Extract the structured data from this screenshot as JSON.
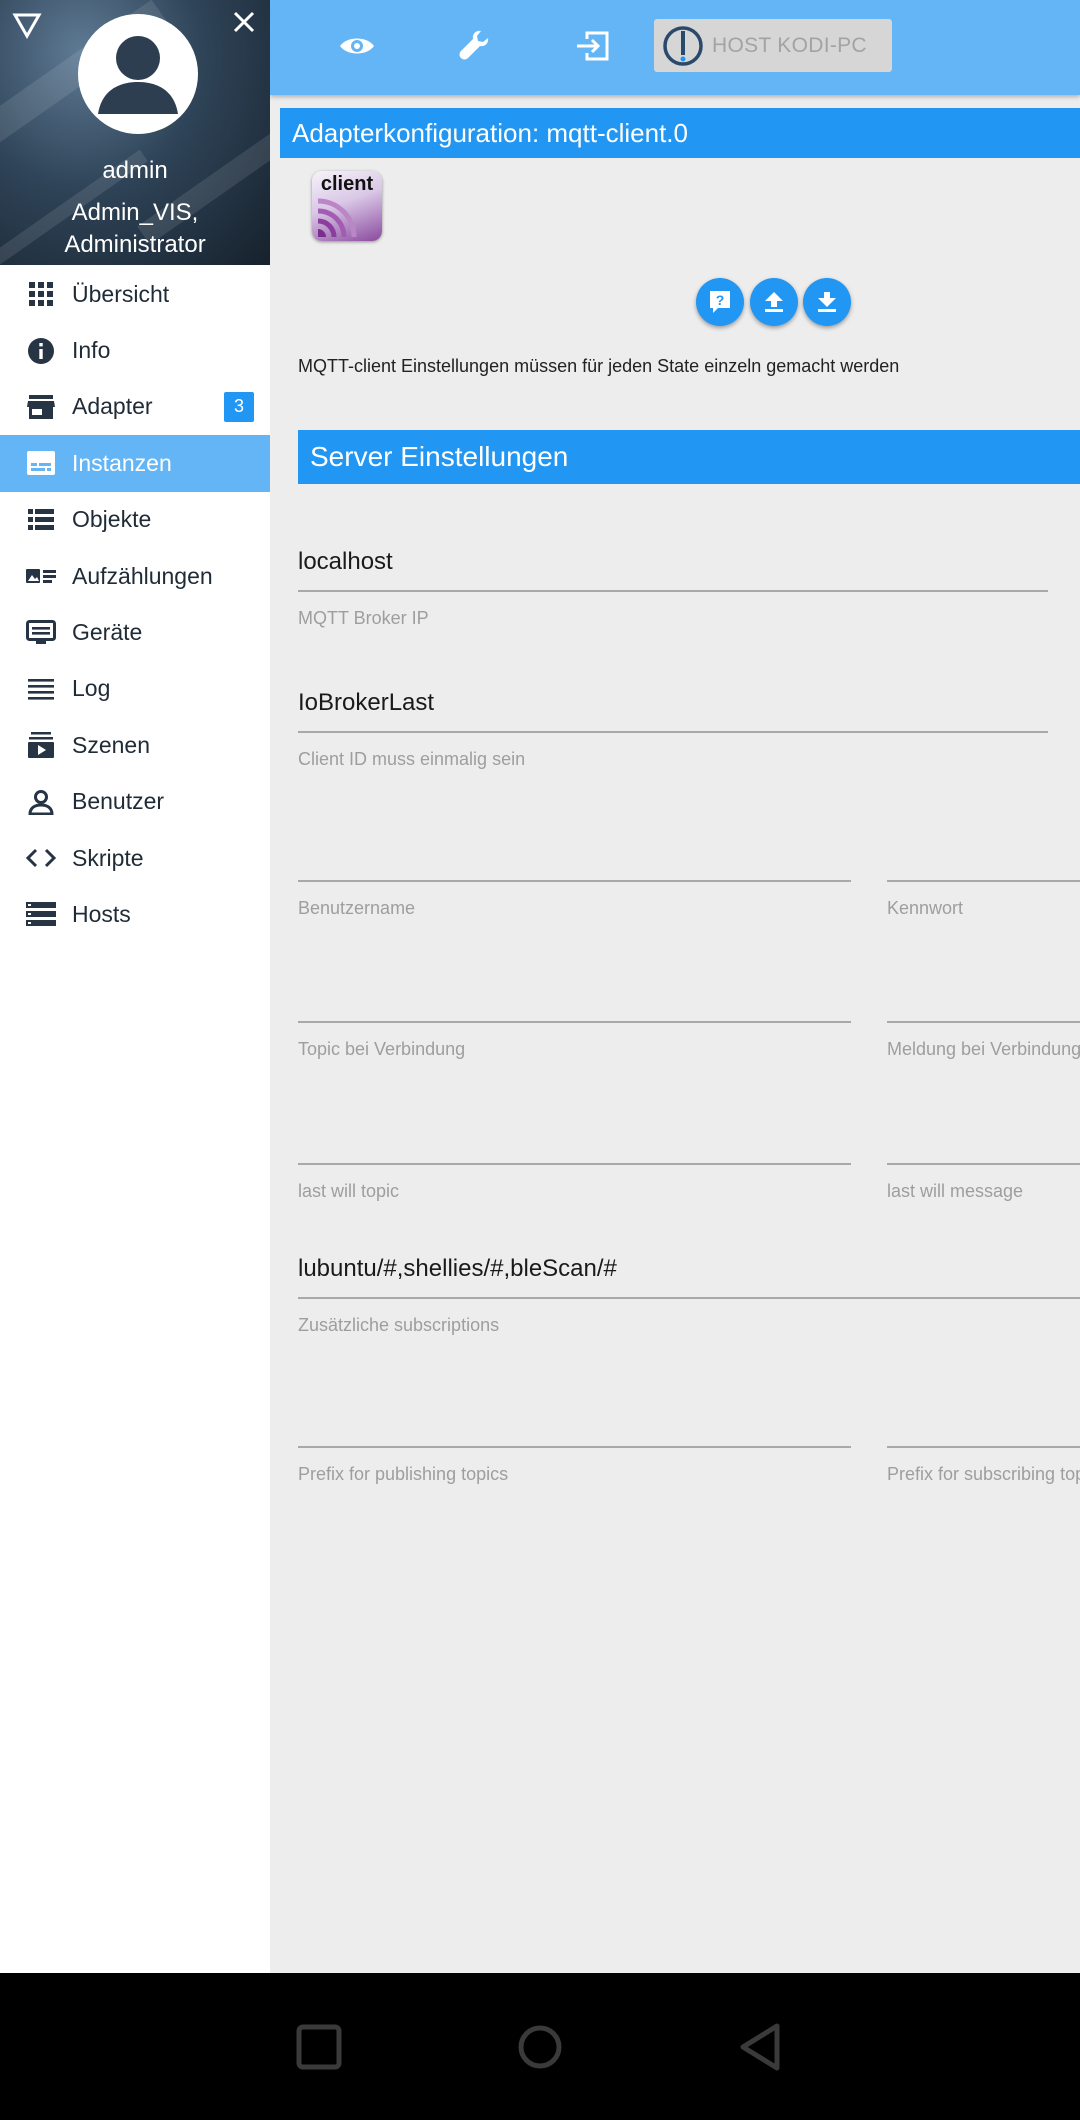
{
  "sidebar": {
    "user": {
      "name": "admin",
      "groups_line1": "Admin_VIS,",
      "groups_line2": "Administrator"
    },
    "items": [
      {
        "label": "Übersicht",
        "icon": "apps-grid-icon"
      },
      {
        "label": "Info",
        "icon": "info-icon"
      },
      {
        "label": "Adapter",
        "icon": "store-icon",
        "badge": "3"
      },
      {
        "label": "Instanzen",
        "icon": "subtitles-icon",
        "active": true
      },
      {
        "label": "Objekte",
        "icon": "list-icon"
      },
      {
        "label": "Aufzählungen",
        "icon": "enum-card-icon"
      },
      {
        "label": "Geräte",
        "icon": "devices-icon"
      },
      {
        "label": "Log",
        "icon": "lines-icon"
      },
      {
        "label": "Szenen",
        "icon": "scenes-icon"
      },
      {
        "label": "Benutzer",
        "icon": "person-icon"
      },
      {
        "label": "Skripte",
        "icon": "code-icon"
      },
      {
        "label": "Hosts",
        "icon": "storage-icon"
      }
    ]
  },
  "topbar": {
    "icons": [
      "eye-icon",
      "wrench-icon",
      "logout-icon"
    ],
    "host_label": "HOST KODI-PC"
  },
  "config": {
    "title": "Adapterkonfiguration: mqtt-client.0",
    "logo_text": "client",
    "action_icons": [
      "help-icon",
      "upload-icon",
      "download-icon"
    ],
    "description": "MQTT-client Einstellungen müssen für jeden State einzeln gemacht werden",
    "section_title": "Server Einstellungen",
    "fields": {
      "broker_ip": {
        "value": "localhost",
        "hint": "MQTT Broker IP"
      },
      "client_id": {
        "value": "IoBrokerLast",
        "hint": "Client ID muss einmalig sein"
      },
      "username": {
        "value": "",
        "hint": "Benutzername"
      },
      "password": {
        "value": "",
        "hint": "Kennwort"
      },
      "connect_topic": {
        "value": "",
        "hint": "Topic bei Verbindung"
      },
      "connect_message": {
        "value": "",
        "hint": "Meldung bei Verbindung"
      },
      "lastwill_topic": {
        "value": "",
        "hint": "last will topic"
      },
      "lastwill_message": {
        "value": "",
        "hint": "last will message"
      },
      "subscriptions": {
        "value": "lubuntu/#,shellies/#,bleScan/#",
        "hint": "Zusätzliche subscriptions"
      },
      "publish_prefix": {
        "value": "",
        "hint": "Prefix for publishing topics"
      },
      "subscribe_prefix": {
        "value": "",
        "hint": "Prefix for subscribing topics"
      }
    }
  },
  "system_nav": {
    "icons": [
      "recents-square-icon",
      "home-circle-icon",
      "back-triangle-icon"
    ]
  },
  "colors": {
    "accent": "#2196f3",
    "active_item": "#64b5f6",
    "sidebar_text": "#1f2b36",
    "content_bg": "#ededed"
  }
}
